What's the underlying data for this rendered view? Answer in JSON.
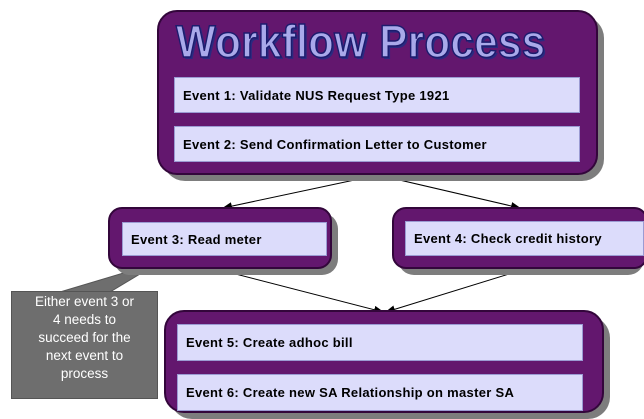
{
  "title": "Workflow Process",
  "events": {
    "e1": "Event 1: Validate NUS Request Type 1921",
    "e2": "Event 2: Send Confirmation Letter to Customer",
    "e3": "Event 3: Read meter",
    "e4": "Event 4: Check credit history",
    "e5": "Event 5: Create adhoc bill",
    "e6": "Event 6: Create new SA Relationship on master SA"
  },
  "note": {
    "lines": [
      "Either event 3 or",
      "4 needs to",
      "succeed for the",
      "next event to",
      "process"
    ]
  },
  "colors": {
    "container": "#63176e",
    "event_fill": "#dcdcfb",
    "title_fill": "#a9a9ea",
    "note_fill": "#6e6e6e",
    "arrow": "#000000"
  }
}
